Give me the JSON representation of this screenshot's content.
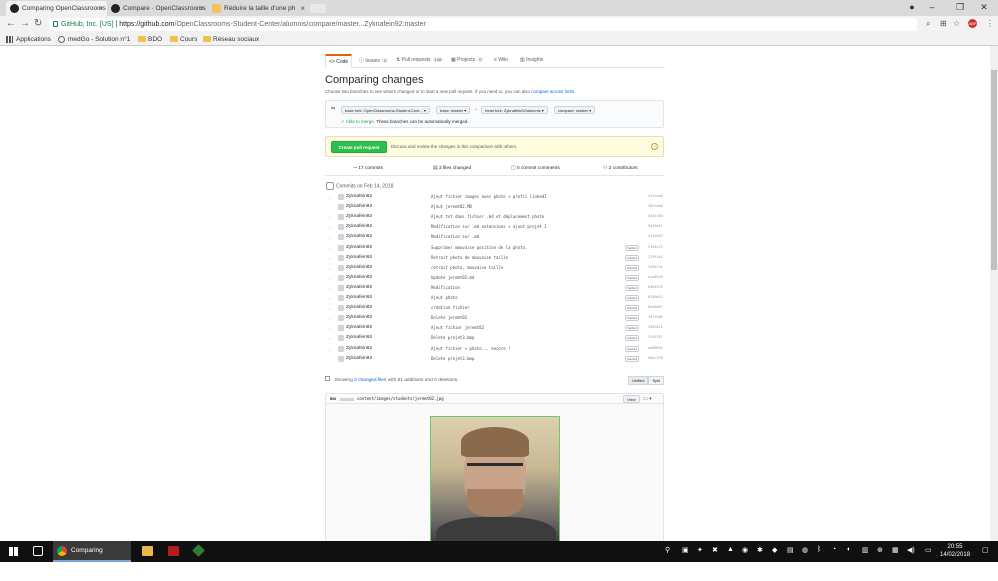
{
  "browser": {
    "tabs": [
      {
        "title": "Comparing OpenClassrooms",
        "active": true
      },
      {
        "title": "Compare · OpenClassrooms",
        "active": false
      },
      {
        "title": "Réduire la taille d'une ph",
        "active": false
      }
    ],
    "url_security_label": "GitHub, Inc. [US]",
    "url_main": "https://github.com",
    "url_rest": "/OpenClassrooms-Student-Center/alumnis/compare/master...Zyknafein92:master",
    "bookmarks": [
      "Applications",
      "medGo - Solution n°1",
      "BDO",
      "Cours",
      "Réseau sociaux"
    ]
  },
  "repo_tabs": [
    {
      "label": "Code",
      "selected": true,
      "count": ""
    },
    {
      "label": "Issues",
      "selected": false,
      "count": "0"
    },
    {
      "label": "Pull requests",
      "selected": false,
      "count": "148"
    },
    {
      "label": "Projects",
      "selected": false,
      "count": "0"
    },
    {
      "label": "Wiki",
      "selected": false,
      "count": ""
    },
    {
      "label": "Insights",
      "selected": false,
      "count": ""
    }
  ],
  "compare": {
    "title": "Comparing changes",
    "subtitle": "Choose two branches to see what's changed or to start a new pull request. If you need to, you can also",
    "subtitle_link": "compare across forks.",
    "base_fork": "base fork: OpenClassrooms-Student-Cent... ▾",
    "base": "base: master ▾",
    "head_fork": "head fork: Zyknafein92/alumnis ▾",
    "compare_branch": "compare: master ▾",
    "merge_status": "✓ Able to merge.",
    "merge_note": "These branches can be automatically merged.",
    "pr_button": "Create pull request",
    "pr_note": "Discuss and review the changes in this comparison with others."
  },
  "stats": {
    "commits": "17 commits",
    "files": "3 files changed",
    "comments": "0 commit comments",
    "contributors": "2 contributors"
  },
  "commits_date": "Commits on Feb 14, 2018",
  "commits": [
    {
      "author": "Zyknafein92",
      "message": "Ajout fichier images avec photo + profil linkedI",
      "verified": false,
      "sha": "c2fccb8"
    },
    {
      "author": "Zyknafein92",
      "message": "Ajout jeremt02.MD",
      "verified": false,
      "sha": "305faa6"
    },
    {
      "author": "Zyknafein92",
      "message": "Ajout txt dans fichier .md et déplacement photo",
      "verified": false,
      "sha": "3344c66"
    },
    {
      "author": "Zyknafein92",
      "message": "Modification sur .md extensions + ajout projet 1",
      "verified": false,
      "sha": "9a13e41"
    },
    {
      "author": "Zyknafein92",
      "message": "Modification sur .md",
      "verified": false,
      "sha": "4f2e583"
    },
    {
      "author": "Zyknafein92",
      "message": "Supprimer mauvaise position de la photo.",
      "verified": true,
      "sha": "51d4c72"
    },
    {
      "author": "Zyknafein92",
      "message": "Retrait photo de mauvaise taille",
      "verified": true,
      "sha": "279f1b1"
    },
    {
      "author": "Zyknafein92",
      "message": "retrait photo, mauvaise taille",
      "verified": true,
      "sha": "7a9ef2e"
    },
    {
      "author": "Zyknafein92",
      "message": "Update jeremt02.md",
      "verified": true,
      "sha": "b1a89c6"
    },
    {
      "author": "Zyknafein92",
      "message": "Modification",
      "verified": true,
      "sha": "6484293"
    },
    {
      "author": "Zyknafein92",
      "message": "Ajout photo",
      "verified": true,
      "sha": "0f30b12"
    },
    {
      "author": "Zyknafein92",
      "message": "création fichier",
      "verified": true,
      "sha": "0ba6d67"
    },
    {
      "author": "Zyknafein92",
      "message": "Delete jeremt02",
      "verified": true,
      "sha": "1017e86"
    },
    {
      "author": "Zyknafein92",
      "message": "Ajout fichier jeremt02",
      "verified": true,
      "sha": "3382814"
    },
    {
      "author": "Zyknafein92",
      "message": "Delete projet3.bmp",
      "verified": true,
      "sha": "2fd5781"
    },
    {
      "author": "Zyknafein92",
      "message": "Ajout fichier + photo... encore !",
      "verified": true,
      "sha": "ee88894"
    },
    {
      "author": "Zyknafein92",
      "message": "Delete projet3.bmp",
      "verified": true,
      "sha": "9dacf50"
    }
  ],
  "verified_label": "Verified",
  "files_summary": {
    "prefix": "Showing",
    "link": "3 changed files",
    "suffix": "with 51 additions and 0 deletions.",
    "unified": "Unified",
    "split": "Split"
  },
  "file": {
    "bin_label": "BIN",
    "path": "content/images/students/jeremt02.jpg",
    "view_label": "View"
  },
  "taskbar": {
    "app_label": "Comparing OpenCl...",
    "time": "20:55",
    "date": "14/02/2018"
  }
}
